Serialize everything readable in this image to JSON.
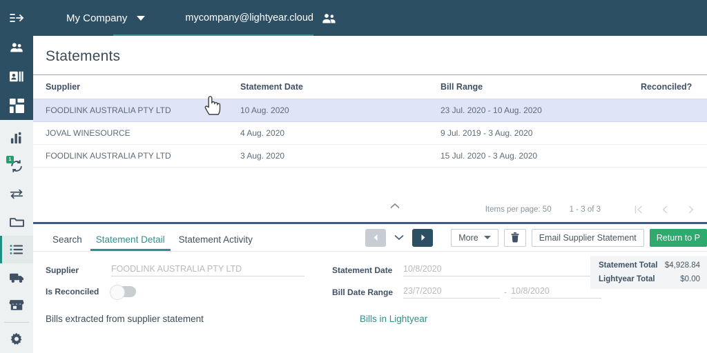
{
  "topbar": {
    "menu_icon": "hamburger-collapse-icon",
    "company_name": "My Company",
    "company_caret": "chevron-down-icon",
    "account_email": "mycompany@lightyear.cloud",
    "account_icon": "people-icon"
  },
  "sidebar": {
    "items": [
      {
        "name": "suppliers",
        "icon": "people-icon",
        "group": "top",
        "active": false
      },
      {
        "name": "contacts",
        "icon": "id-card-icon",
        "group": "top",
        "active": false
      },
      {
        "name": "dashboard",
        "icon": "grid-icon",
        "group": "top",
        "active": false
      },
      {
        "name": "reports",
        "icon": "bar-chart-icon",
        "group": "bottom",
        "active": false
      },
      {
        "name": "sync",
        "icon": "sync-icon",
        "group": "bottom",
        "active": false,
        "badge": "1"
      },
      {
        "name": "transfers",
        "icon": "arrows-swap-icon",
        "group": "bottom",
        "active": false
      },
      {
        "name": "files",
        "icon": "folder-icon",
        "group": "bottom",
        "active": false
      },
      {
        "name": "statements",
        "icon": "list-icon",
        "group": "bottom",
        "active": true
      },
      {
        "name": "deliveries",
        "icon": "truck-icon",
        "group": "bottom",
        "active": false
      },
      {
        "name": "store",
        "icon": "store-icon",
        "group": "bottom",
        "active": false
      },
      {
        "name": "settings",
        "icon": "gear-icon",
        "group": "bottom",
        "active": false
      }
    ]
  },
  "page": {
    "title": "Statements"
  },
  "table": {
    "columns": [
      "Supplier",
      "Statement Date",
      "Bill Range",
      "Reconciled?"
    ],
    "rows": [
      {
        "supplier": "FOODLINK AUSTRALIA PTY LTD",
        "statement_date": "10 Aug. 2020",
        "bill_range": "23 Jul. 2020 - 10 Aug. 2020",
        "reconciled": "",
        "selected": true
      },
      {
        "supplier": "JOVAL WINESOURCE",
        "statement_date": "4 Aug. 2020",
        "bill_range": "9 Jul. 2019 - 3 Aug. 2020",
        "reconciled": "",
        "selected": false
      },
      {
        "supplier": "FOODLINK AUSTRALIA PTY LTD",
        "statement_date": "3 Aug. 2020",
        "bill_range": "15 Jul. 2020 - 3 Aug. 2020",
        "reconciled": "",
        "selected": false
      }
    ]
  },
  "paginator": {
    "items_per_page_label": "Items per page: 50",
    "range_label": "1 - 3 of 3",
    "first_icon": "first-page-icon",
    "prev_icon": "chevron-left-icon",
    "next_icon": "chevron-right-icon",
    "collapse_icon": "chevron-up-icon"
  },
  "detail": {
    "tabs": [
      {
        "label": "Search",
        "active": false
      },
      {
        "label": "Statement Detail",
        "active": true
      },
      {
        "label": "Statement Activity",
        "active": false
      }
    ],
    "toolbar": {
      "expand_icon": "chevron-down-icon",
      "prev_record_icon": "arrow-left-icon",
      "next_record_icon": "arrow-right-icon",
      "more_label": "More",
      "more_caret": "chevron-down-icon",
      "delete_icon": "trash-icon",
      "email_label": "Email Supplier Statement",
      "return_label": "Return to P",
      "return_color": "#2eaa6e"
    },
    "form": {
      "supplier_label": "Supplier",
      "supplier_value": "FOODLINK AUSTRALIA PTY LTD",
      "is_reconciled_label": "Is Reconciled",
      "is_reconciled_value": "off",
      "statement_date_label": "Statement Date",
      "statement_date_value": "10/8/2020",
      "bill_date_range_label": "Bill Date Range",
      "bill_date_from": "23/7/2020",
      "bill_date_separator": "-",
      "bill_date_to": "10/8/2020"
    },
    "totals": {
      "statement_total_label": "Statement Total",
      "statement_total_value": "$4,928.84",
      "lightyear_total_label": "Lightyear Total",
      "lightyear_total_value": "$0.00"
    },
    "bottom": {
      "left_heading": "Bills extracted from supplier statement",
      "right_heading": "Bills in Lightyear"
    }
  },
  "colors": {
    "navy": "#2d4f63",
    "teal": "#2f8f8c",
    "green": "#2eaa6e",
    "row_selected": "#dfe4f7"
  }
}
